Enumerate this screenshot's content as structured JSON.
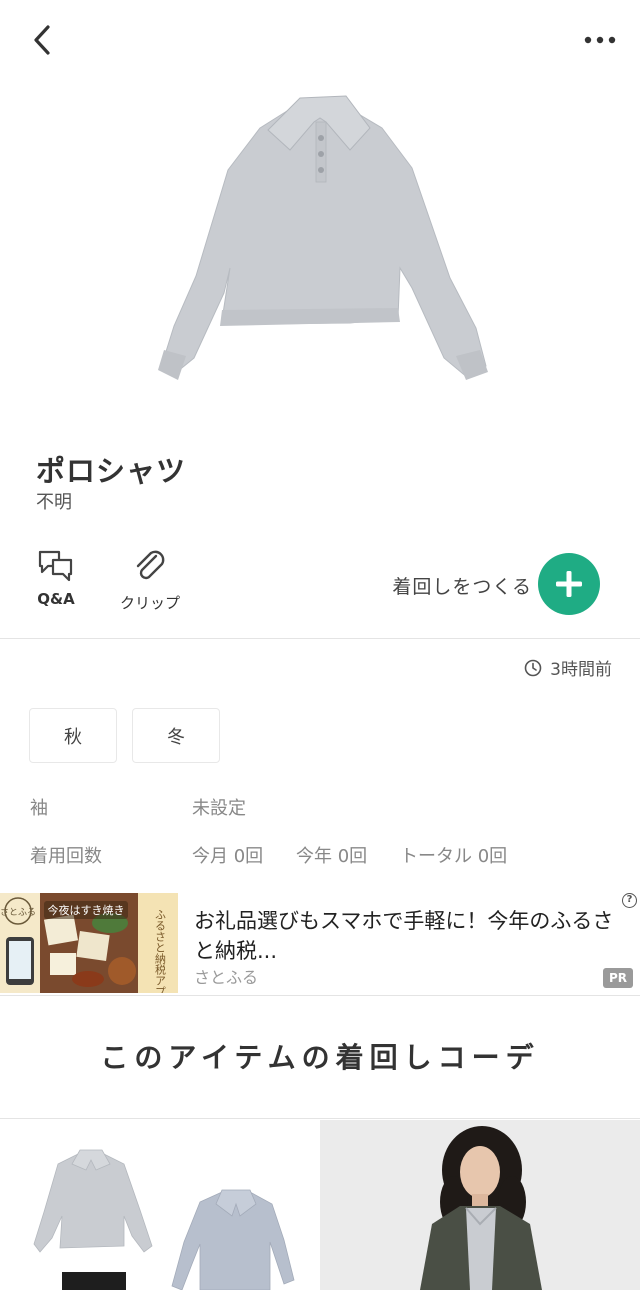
{
  "header": {
    "back_icon": "chevron-left-icon",
    "more_icon": "more-horizontal-icon"
  },
  "product": {
    "name": "ポロシャツ",
    "brand": "不明"
  },
  "actions": {
    "qa_label": "Q&A",
    "clip_label": "クリップ",
    "coordinate_label": "着回しをつくる"
  },
  "meta": {
    "updated": "3時間前"
  },
  "seasons": [
    "秋",
    "冬"
  ],
  "attributes": {
    "sleeve_label": "袖",
    "sleeve_value": "未設定",
    "wear_label": "着用回数",
    "wear_month": "今月 0回",
    "wear_year": "今年 0回",
    "wear_total": "トータル 0回"
  },
  "ad": {
    "image_caption": "今夜はすき焼き",
    "image_logo": "さとふる",
    "image_vertical": "ふるさと納税アプリ",
    "text": "お礼品選びもスマホで手軽に！今年のふるさと納税...",
    "source": "さとふる",
    "badge": "PR",
    "help": "?"
  },
  "coordinates": {
    "title": "このアイテムの着回しコーデ"
  },
  "colors": {
    "accent": "#1fac84",
    "garment": "#c9ccd1"
  }
}
